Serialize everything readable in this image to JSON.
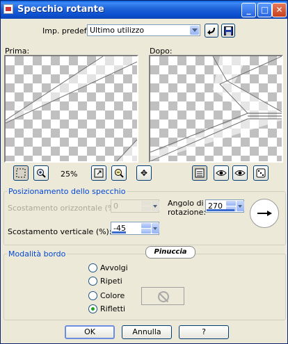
{
  "window": {
    "title": "Specchio rotante"
  },
  "preset": {
    "label": "Imp. predef.:",
    "value": "Ultimo utilizzo"
  },
  "preview": {
    "before_label": "Prima:",
    "after_label": "Dopo:",
    "zoom": "25%"
  },
  "position_group": {
    "title": "Posizionamento dello specchio",
    "horizontal_label": "Scostamento orizzontale (%):",
    "horizontal_value": "0",
    "vertical_label": "Scostamento verticale (%):",
    "vertical_value": "-45",
    "angle_label_line1": "Angolo di",
    "angle_label_line2": "rotazione:",
    "angle_value": "270"
  },
  "watermark": "Pinuccia",
  "edge_group": {
    "title": "Modalità bordo",
    "options": [
      {
        "label": "Avvolgi",
        "selected": false
      },
      {
        "label": "Ripeti",
        "selected": false
      },
      {
        "label": "Colore",
        "selected": false
      },
      {
        "label": "Rifletti",
        "selected": true
      }
    ]
  },
  "buttons": {
    "ok": "OK",
    "cancel": "Annulla",
    "help": "?"
  },
  "icons": [
    "app-icon",
    "minimize-icon",
    "maximize-icon",
    "close-icon",
    "preset-reset-icon",
    "save-preset-icon",
    "marquee-select-icon",
    "zoom-in-icon",
    "fit-preview-icon",
    "zoom-out-icon",
    "move-icon",
    "toggle-preview-icon",
    "eye-proof-icon",
    "eye-icon",
    "randomize-dice-icon",
    "rotation-arrow-icon",
    "no-color-icon"
  ],
  "colors": {
    "title_bar": "#0B4FD0",
    "group_title": "#0046D5",
    "dialog_bg": "#ECE9D8"
  }
}
